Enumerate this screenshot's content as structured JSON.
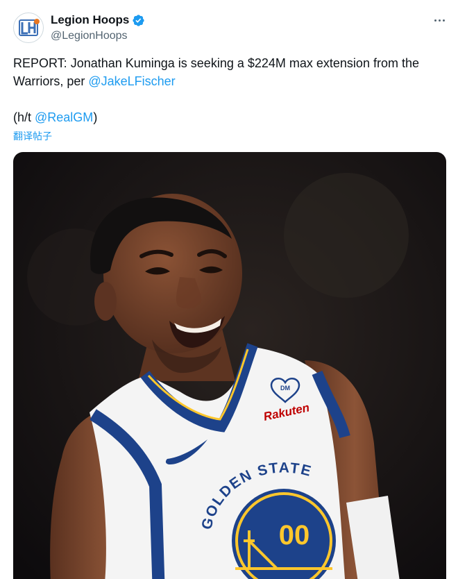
{
  "author": {
    "display_name": "Legion Hoops",
    "handle": "@LegionHoops",
    "verified": true,
    "avatar_icon": "legion-hoops-logo-icon"
  },
  "tweet": {
    "line1_text": "REPORT: Jonathan Kuminga is seeking a $224M max extension from the Warriors, per ",
    "line1_mention": "@JakeLFischer",
    "line2_prefix": "(h/t ",
    "line2_mention": "@RealGM",
    "line2_suffix": ")",
    "translate_label": "翻译帖子"
  },
  "media": {
    "type": "photo",
    "jersey": {
      "team_text": "GOLDEN STATE",
      "number": "00",
      "sponsor": "Rakuten"
    }
  },
  "colors": {
    "accent": "#1d9bf0",
    "text_primary": "#0f1419",
    "text_secondary": "#536471",
    "warriors_blue": "#1d428a",
    "warriors_gold": "#ffc72c"
  },
  "icons": {
    "verified": "verified-badge-icon",
    "more": "more-options-icon"
  }
}
